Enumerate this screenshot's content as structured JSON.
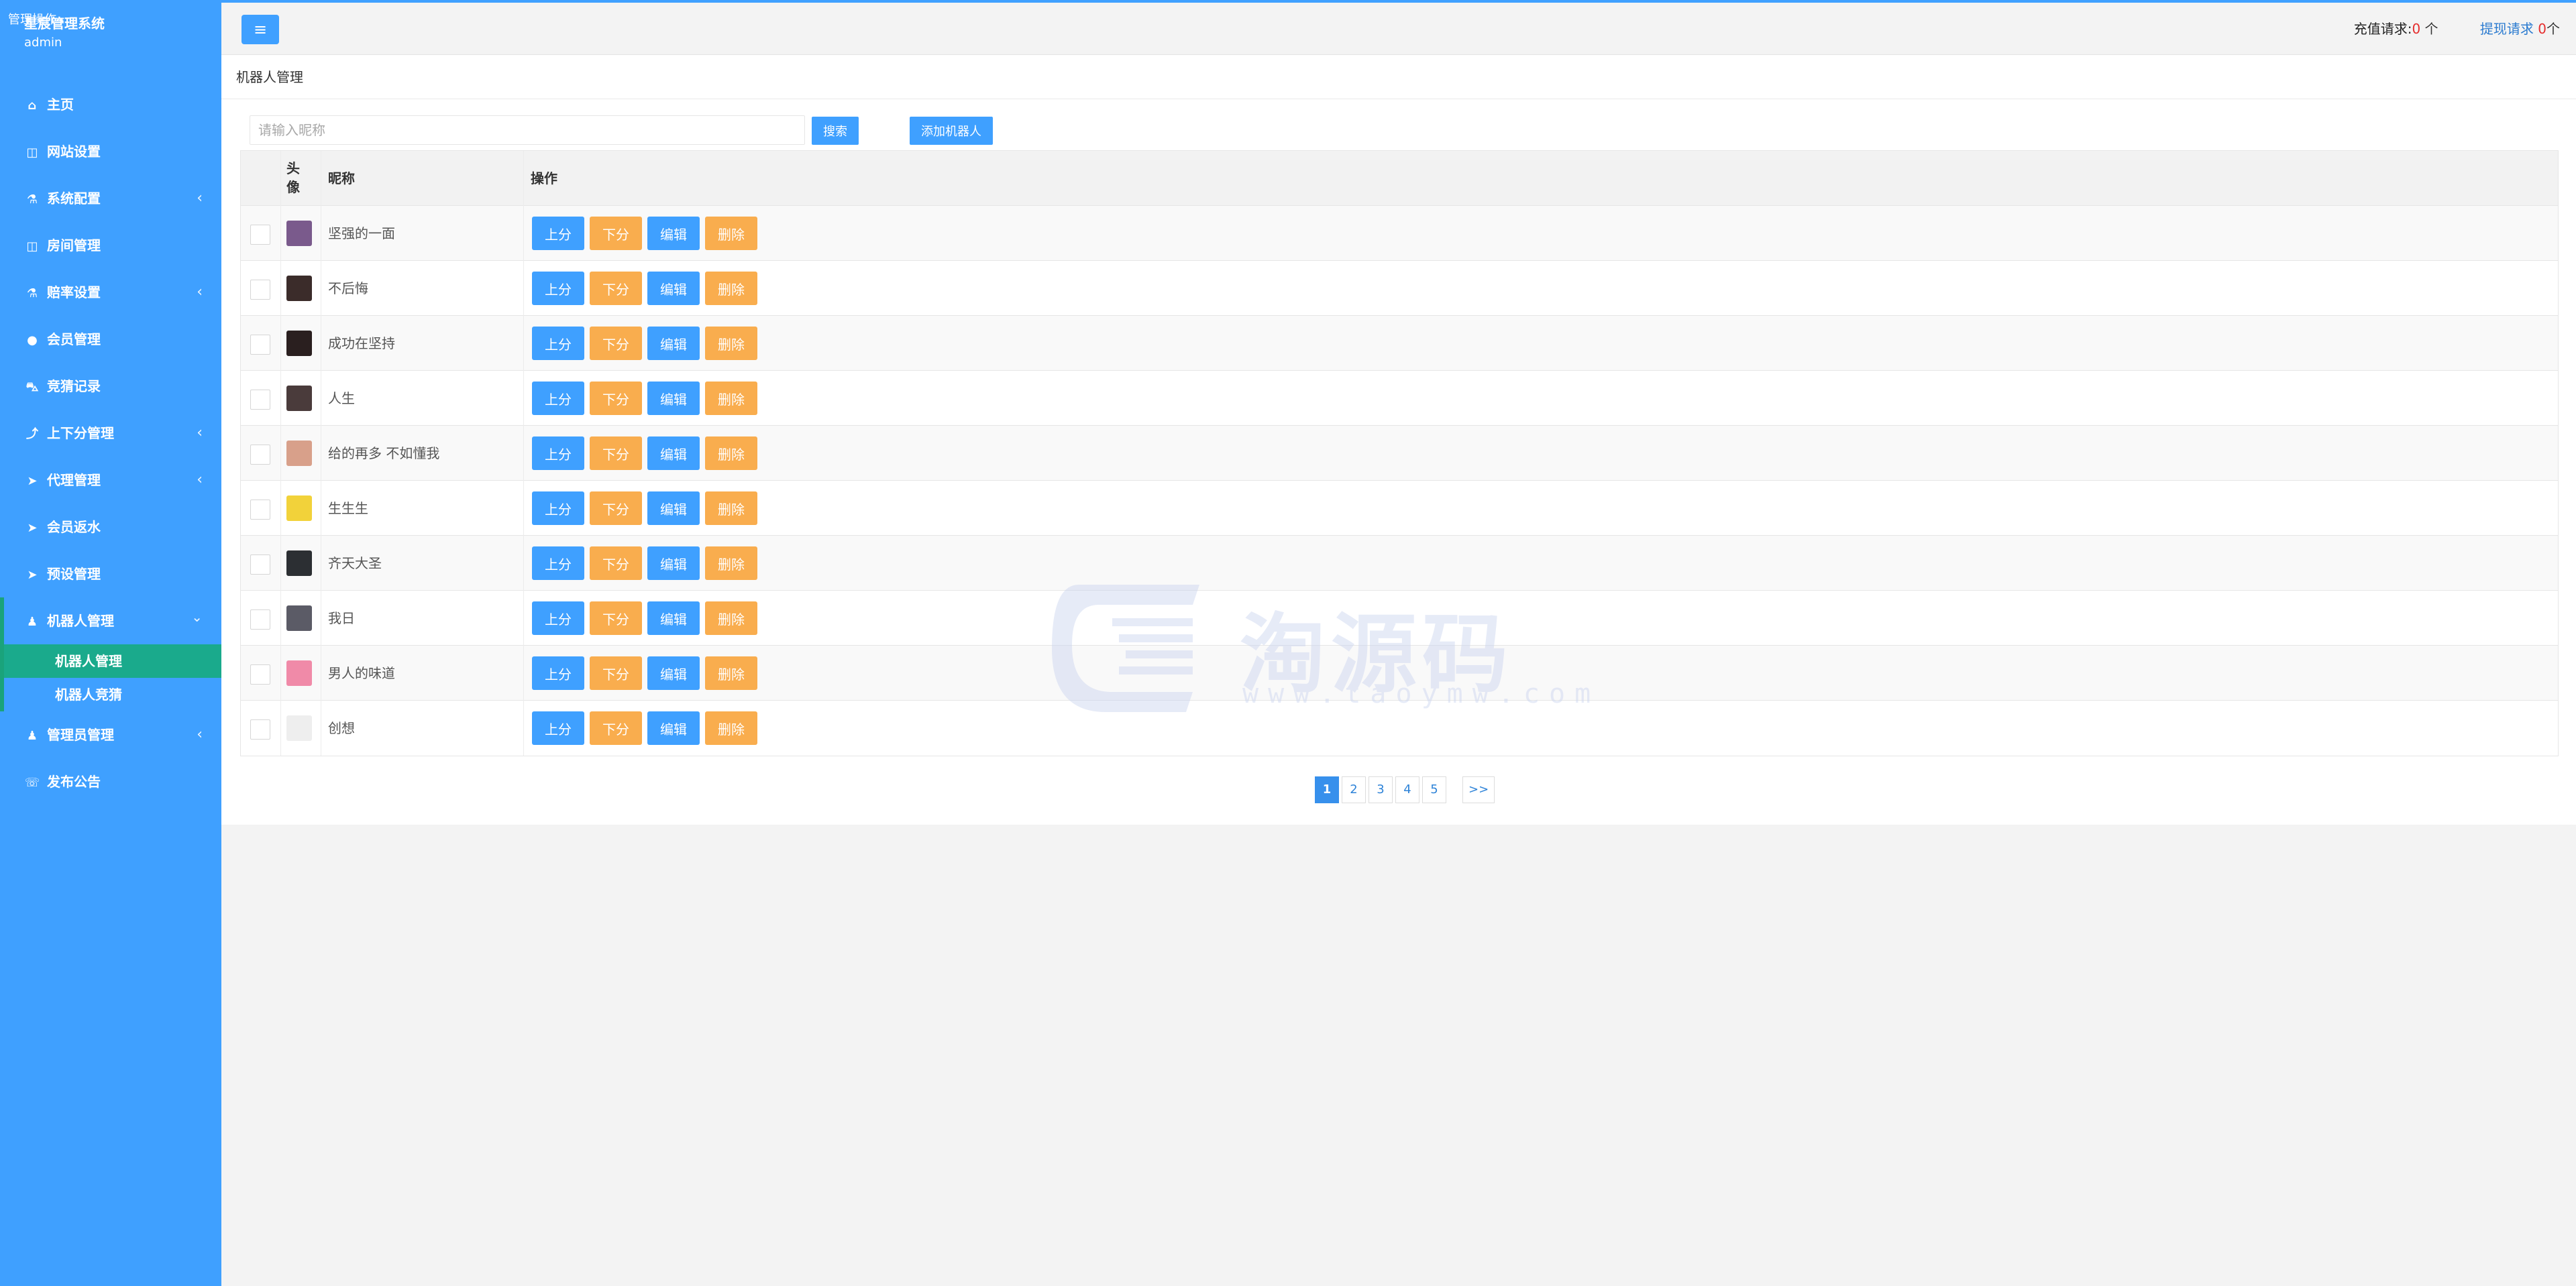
{
  "sidebar": {
    "system_name": "星宸管理系统",
    "username": "admin",
    "ops_label": "管理操作",
    "items": [
      {
        "label": "主页",
        "icon": "home-icon",
        "glyph": "⌂",
        "has_arrow": false
      },
      {
        "label": "网站设置",
        "icon": "columns-icon",
        "glyph": "◫",
        "has_arrow": false
      },
      {
        "label": "系统配置",
        "icon": "flask-icon",
        "glyph": "⚗",
        "has_arrow": true
      },
      {
        "label": "房间管理",
        "icon": "columns-icon",
        "glyph": "◫",
        "has_arrow": false
      },
      {
        "label": "赔率设置",
        "icon": "flask-icon",
        "glyph": "⚗",
        "has_arrow": true
      },
      {
        "label": "会员管理",
        "icon": "user-icon",
        "glyph": "●",
        "has_arrow": false
      },
      {
        "label": "竞猜记录",
        "icon": "car-icon",
        "glyph": "⛍",
        "has_arrow": false
      },
      {
        "label": "上下分管理",
        "icon": "level-up-icon",
        "glyph": "⤴",
        "has_arrow": true
      },
      {
        "label": "代理管理",
        "icon": "paper-plane-icon",
        "glyph": "➤",
        "has_arrow": true
      },
      {
        "label": "会员返水",
        "icon": "paper-plane-icon",
        "glyph": "➤",
        "has_arrow": false
      },
      {
        "label": "预设管理",
        "icon": "paper-plane-icon",
        "glyph": "➤",
        "has_arrow": false
      }
    ],
    "open_item": {
      "label": "机器人管理",
      "icon": "male-icon",
      "glyph": "♟"
    },
    "sub_items": [
      {
        "label": "机器人管理",
        "active": true
      },
      {
        "label": "机器人竞猜",
        "active": false
      }
    ],
    "after_items": [
      {
        "label": "管理员管理",
        "icon": "male-icon",
        "glyph": "♟",
        "has_arrow": true
      },
      {
        "label": "发布公告",
        "icon": "comment-icon",
        "glyph": "☏",
        "has_arrow": false
      }
    ]
  },
  "topbar": {
    "toggle_glyph": "≡",
    "recharge": {
      "label": "充值请求:",
      "count": "0",
      "unit": " 个"
    },
    "withdraw": {
      "label": "提现请求",
      "count": "0",
      "unit": "个"
    }
  },
  "panel": {
    "title": "机器人管理",
    "search_placeholder": "请输入昵称",
    "search_label": "搜索",
    "add_label": "添加机器人"
  },
  "table": {
    "headers": {
      "avatar": "头像",
      "name": "昵称",
      "ops": "操作"
    },
    "op_labels": {
      "up": "上分",
      "down": "下分",
      "edit": "编辑",
      "del": "删除"
    },
    "rows": [
      {
        "name": "坚强的一面",
        "avatar_color": "#7a5a8c"
      },
      {
        "name": "不后悔",
        "avatar_color": "#3b2c2a"
      },
      {
        "name": "成功在坚持",
        "avatar_color": "#2a1f1f"
      },
      {
        "name": "人生",
        "avatar_color": "#4a3b3b"
      },
      {
        "name": "给的再多 不如懂我",
        "avatar_color": "#d8a08a"
      },
      {
        "name": "生生生",
        "avatar_color": "#f2d23a"
      },
      {
        "name": "齐天大圣",
        "avatar_color": "#2c2f33"
      },
      {
        "name": "我日",
        "avatar_color": "#5b5b66"
      },
      {
        "name": "男人的味道",
        "avatar_color": "#f08aa8"
      },
      {
        "name": "创想",
        "avatar_color": "#eeeeee"
      }
    ]
  },
  "pagination": {
    "pages": [
      "1",
      "2",
      "3",
      "4",
      "5"
    ],
    "current": "1",
    "next_label": ">>"
  },
  "watermark": {
    "text": "淘源码",
    "url": "www.taoymw.com"
  }
}
